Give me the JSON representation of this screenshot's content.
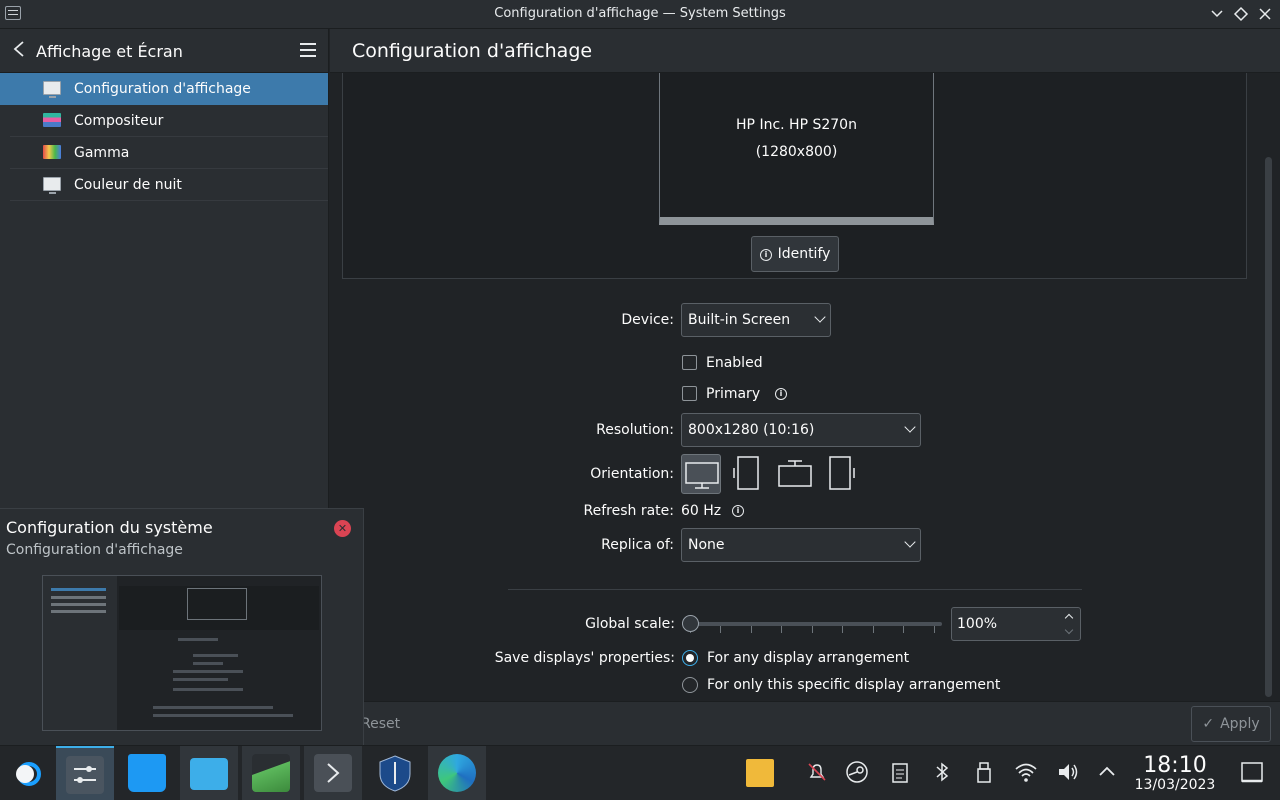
{
  "window": {
    "title": "Configuration d'affichage — System Settings"
  },
  "sidebar": {
    "title": "Affichage et Écran",
    "items": [
      {
        "label": "Configuration d'affichage",
        "icon": "monitor-icon",
        "active": true
      },
      {
        "label": "Compositeur",
        "icon": "compositor-icon",
        "active": false
      },
      {
        "label": "Gamma",
        "icon": "gamma-icon",
        "active": false
      },
      {
        "label": "Couleur de nuit",
        "icon": "night-color-icon",
        "active": false
      }
    ]
  },
  "main": {
    "page_title": "Configuration d'affichage",
    "monitor": {
      "name": "HP Inc. HP S270n",
      "resolution": "(1280x800)"
    },
    "identify_label": "Identify",
    "device": {
      "label": "Device:",
      "value": "Built-in Screen"
    },
    "enabled": {
      "label": "Enabled",
      "checked": false
    },
    "primary": {
      "label": "Primary",
      "checked": false
    },
    "resolution": {
      "label": "Resolution:",
      "value": "800x1280 (10:16)"
    },
    "orientation": {
      "label": "Orientation:",
      "options": [
        "landscape",
        "portrait-left",
        "landscape-flipped",
        "portrait-right"
      ],
      "selected": 0
    },
    "refresh_rate": {
      "label": "Refresh rate:",
      "value": "60 Hz"
    },
    "replica_of": {
      "label": "Replica of:",
      "value": "None"
    },
    "global_scale": {
      "label": "Global scale:",
      "value": "100%",
      "slider_fraction": 0.0
    },
    "save_properties": {
      "label": "Save displays' properties:",
      "options": [
        "For any display arrangement",
        "For only this specific display arrangement"
      ],
      "selected": 0
    },
    "reset_label": "Reset",
    "apply_label": "Apply"
  },
  "popup": {
    "title": "Configuration du système",
    "subtitle": "Configuration d'affichage"
  },
  "taskbar": {
    "time": "18:10",
    "date": "13/03/2023"
  },
  "colors": {
    "accent": "#3d7aab",
    "background": "#202326",
    "panel": "#2a2e32"
  }
}
